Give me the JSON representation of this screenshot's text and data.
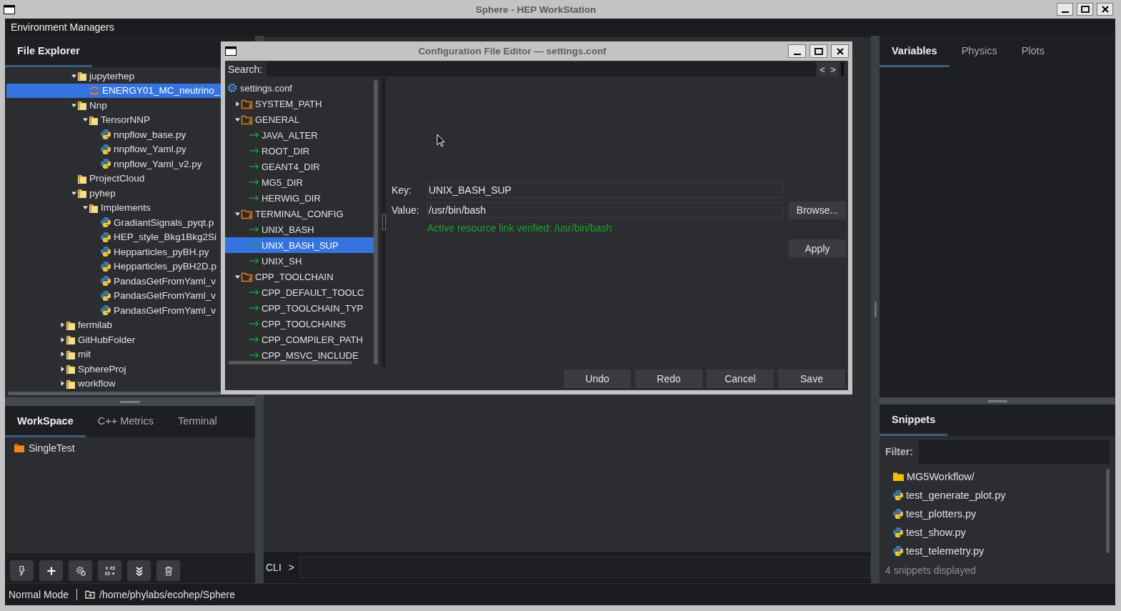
{
  "window": {
    "title": "Sphere - HEP WorkStation"
  },
  "environment_bar": {
    "label": "Environment Managers"
  },
  "file_explorer": {
    "tabs": [
      {
        "label": "File Explorer",
        "selected": true
      }
    ],
    "tree": {
      "scrolled_children": [
        {
          "label": "jupyterhep",
          "kind": "folder",
          "expanded": true,
          "selected": false,
          "children": [
            {
              "label": "ENERGY01_MC_neutrino_",
              "kind": "notebook",
              "selected": true
            }
          ]
        },
        {
          "label": "Nnp",
          "kind": "folder",
          "expanded": true,
          "selected": false,
          "children": [
            {
              "label": "TensorNNP",
              "kind": "folder",
              "expanded": true,
              "selected": false,
              "children": [
                {
                  "label": "nnpflow_base.py",
                  "kind": "python",
                  "selected": false
                },
                {
                  "label": "nnpflow_Yaml.py",
                  "kind": "python",
                  "selected": false
                },
                {
                  "label": "nnpflow_Yaml_v2.py",
                  "kind": "python",
                  "selected": false
                }
              ]
            }
          ]
        },
        {
          "label": "ProjectCloud",
          "kind": "folder",
          "selected": false
        },
        {
          "label": "pyhep",
          "kind": "folder",
          "expanded": true,
          "selected": false,
          "children": [
            {
              "label": "Implements",
              "kind": "folder",
              "expanded": true,
              "selected": false,
              "children": [
                {
                  "label": "GradiantSignals_pyqt.p",
                  "kind": "python",
                  "selected": false
                },
                {
                  "label": "HEP_style_Bkg1Bkg2Si",
                  "kind": "python",
                  "selected": false
                },
                {
                  "label": "Hepparticles_pyBH.py",
                  "kind": "python",
                  "selected": false
                },
                {
                  "label": "Hepparticles_pyBH2D.p",
                  "kind": "python",
                  "selected": false
                },
                {
                  "label": "PandasGetFromYaml_v",
                  "kind": "python",
                  "selected": false
                },
                {
                  "label": "PandasGetFromYaml_v",
                  "kind": "python",
                  "selected": false
                },
                {
                  "label": "PandasGetFromYaml_v",
                  "kind": "python",
                  "selected": false
                }
              ]
            }
          ]
        }
      ],
      "items": [
        {
          "label": "fermilab",
          "kind": "folder",
          "expanded": false,
          "selected": false
        },
        {
          "label": "GitHubFolder",
          "kind": "folder",
          "expanded": false,
          "selected": false
        },
        {
          "label": "mit",
          "kind": "folder",
          "expanded": false,
          "selected": false
        },
        {
          "label": "SphereProj",
          "kind": "folder",
          "expanded": false,
          "selected": false
        },
        {
          "label": "workflow",
          "kind": "folder",
          "expanded": false,
          "selected": false
        }
      ]
    }
  },
  "bottom_panel": {
    "tabs": [
      {
        "label": "WorkSpace",
        "selected": true
      },
      {
        "label": "C++ Metrics",
        "selected": false
      },
      {
        "label": "Terminal",
        "selected": false
      }
    ],
    "items": [
      {
        "label": "SingleTest",
        "kind": "project"
      }
    ]
  },
  "center": {
    "cli": {
      "label": "CLI",
      "prompt": ">"
    }
  },
  "right_panel": {
    "tabs": [
      {
        "label": "Variables",
        "selected": true
      },
      {
        "label": "Physics",
        "selected": false
      },
      {
        "label": "Plots",
        "selected": false
      }
    ],
    "snippets": {
      "tabs": [
        {
          "label": "Snippets",
          "selected": true
        }
      ],
      "filter": {
        "label": "Filter:"
      },
      "items": [
        {
          "label": "MG5Workflow/",
          "kind": "folder"
        },
        {
          "label": "test_generate_plot.py",
          "kind": "python"
        },
        {
          "label": "test_plotters.py",
          "kind": "python"
        },
        {
          "label": "test_show.py",
          "kind": "python"
        },
        {
          "label": "test_telemetry.py",
          "kind": "python"
        }
      ],
      "count": "4 snippets displayed"
    }
  },
  "status_bar": {
    "mode": "Normal Mode",
    "path": "/home/phylabs/ecohep/Sphere"
  },
  "dialog": {
    "title": "Configuration File Editor — settings.conf",
    "search": {
      "label": "Search:",
      "buttons": [
        "<",
        ">"
      ]
    },
    "tree": {
      "items": [
        {
          "label": "settings.conf",
          "kind": "file",
          "selected": false,
          "children": [
            {
              "label": "SYSTEM_PATH",
              "kind": "section",
              "expanded": false,
              "selected": false
            },
            {
              "label": "GENERAL",
              "kind": "section",
              "expanded": true,
              "selected": false,
              "children": [
                {
                  "label": "JAVA_ALTER",
                  "kind": "key",
                  "selected": false
                },
                {
                  "label": "ROOT_DIR",
                  "kind": "key",
                  "selected": false
                },
                {
                  "label": "GEANT4_DIR",
                  "kind": "key",
                  "selected": false
                },
                {
                  "label": "MG5_DIR",
                  "kind": "key",
                  "selected": false
                },
                {
                  "label": "HERWIG_DIR",
                  "kind": "key",
                  "selected": false
                }
              ]
            },
            {
              "label": "TERMINAL_CONFIG",
              "kind": "section",
              "expanded": true,
              "selected": false,
              "children": [
                {
                  "label": "UNIX_BASH",
                  "kind": "key",
                  "selected": false
                },
                {
                  "label": "UNIX_BASH_SUP",
                  "kind": "key",
                  "selected": true
                },
                {
                  "label": "UNIX_SH",
                  "kind": "key",
                  "selected": false
                }
              ]
            },
            {
              "label": "CPP_TOOLCHAIN",
              "kind": "section",
              "expanded": true,
              "selected": false,
              "children": [
                {
                  "label": "CPP_DEFAULT_TOOLC",
                  "kind": "key",
                  "selected": false
                },
                {
                  "label": "CPP_TOOLCHAIN_TYP",
                  "kind": "key",
                  "selected": false
                },
                {
                  "label": "CPP_TOOLCHAINS",
                  "kind": "key",
                  "selected": false
                },
                {
                  "label": "CPP_COMPILER_PATH",
                  "kind": "key",
                  "selected": false
                },
                {
                  "label": "CPP_MSVC_INCLUDE",
                  "kind": "key",
                  "selected": false
                }
              ]
            }
          ]
        }
      ]
    },
    "form": {
      "key_label": "Key:",
      "key": "UNIX_BASH_SUP",
      "value_label": "Value:",
      "value": "/usr/bin/bash",
      "browse": "Browse...",
      "status": "Active resource link verified: /usr/bin/bash",
      "apply": "Apply"
    },
    "buttons": [
      "Undo",
      "Redo",
      "Cancel",
      "Save"
    ]
  }
}
